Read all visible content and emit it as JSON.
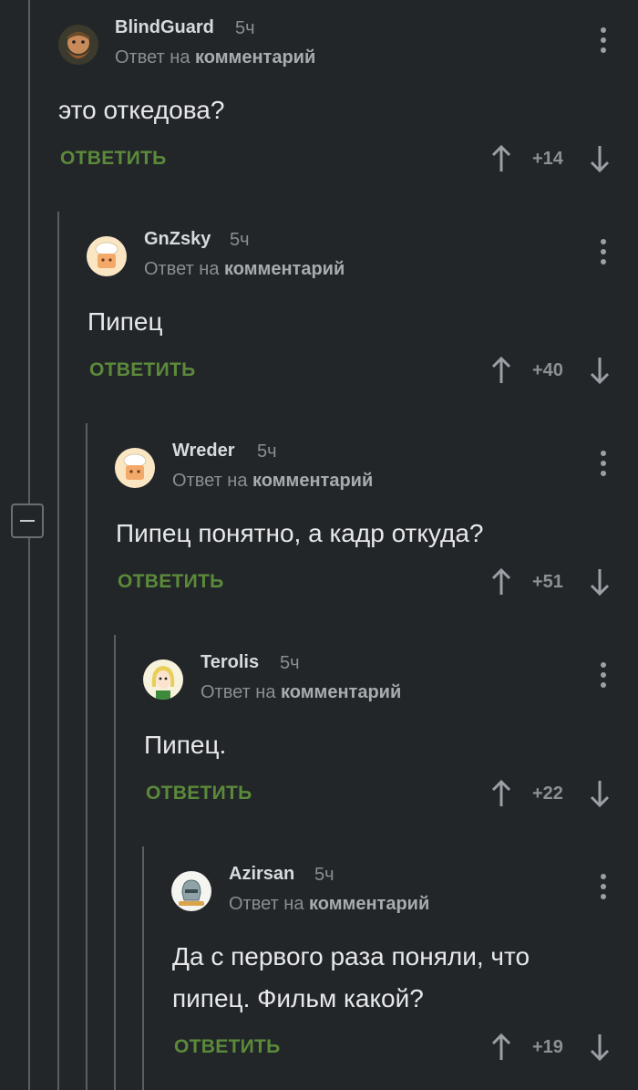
{
  "comments": [
    {
      "username": "BlindGuard",
      "time": "5ч",
      "reply_prefix": "Ответ на",
      "reply_target": "комментарий",
      "text_lines": [
        "это откедова?"
      ],
      "reply_label": "ОТВЕТИТЬ",
      "score": "+14",
      "avatar": "dwarf-avatar"
    },
    {
      "username": "GnZsky",
      "time": "5ч",
      "reply_prefix": "Ответ на",
      "reply_target": "комментарий",
      "text_lines": [
        "Пипец"
      ],
      "reply_label": "ОТВЕТИТЬ",
      "score": "+40",
      "avatar": "chef-avatar"
    },
    {
      "username": "Wreder",
      "time": "5ч",
      "reply_prefix": "Ответ на",
      "reply_target": "комментарий",
      "text_lines": [
        "Пипец понятно, а кадр откуда?"
      ],
      "reply_label": "ОТВЕТИТЬ",
      "score": "+51",
      "avatar": "chef-avatar"
    },
    {
      "username": "Terolis",
      "time": "5ч",
      "reply_prefix": "Ответ на",
      "reply_target": "комментарий",
      "text_lines": [
        "Пипец."
      ],
      "reply_label": "ОТВЕТИТЬ",
      "score": "+22",
      "avatar": "blonde-avatar"
    },
    {
      "username": "Azirsan",
      "time": "5ч",
      "reply_prefix": "Ответ на",
      "reply_target": "комментарий",
      "text_lines": [
        "Да с первого раза поняли, что",
        "пипец. Фильм какой?"
      ],
      "reply_label": "ОТВЕТИТЬ",
      "score": "+19",
      "avatar": "helmet-avatar"
    }
  ],
  "colors": {
    "background": "#232629",
    "reply_green": "#5b8a3a",
    "username": "#d8dbde",
    "muted": "#8a8e93"
  }
}
